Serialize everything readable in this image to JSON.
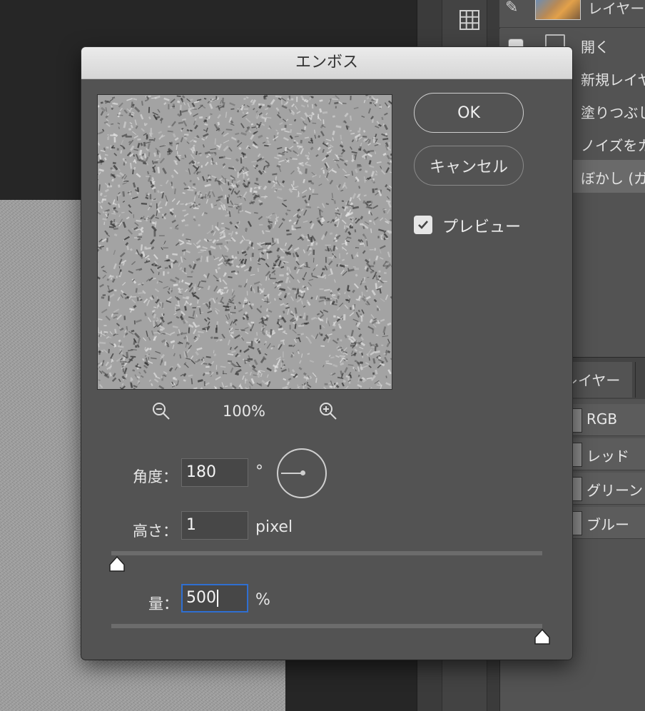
{
  "dialog": {
    "title": "エンボス",
    "ok_label": "OK",
    "cancel_label": "キャンセル",
    "preview_label": "プレビュー",
    "preview_checked": true,
    "zoom_percent": "100%",
    "angle": {
      "label": "角度：",
      "value": "180",
      "unit": "°"
    },
    "height": {
      "label": "高さ：",
      "value": "1",
      "unit": "pixel",
      "slider_fraction": 0.0
    },
    "amount": {
      "label": "量：",
      "value": "500",
      "unit": "%",
      "slider_fraction": 1.0
    }
  },
  "history_panel": {
    "snapshot_label": "レイヤー",
    "items": [
      "開く",
      "新規レイヤ",
      "塗りつぶし",
      "ノイズをカ",
      "ぼかし (ガ"
    ],
    "selected_index": 4
  },
  "layers_tab": {
    "label": "レイヤー"
  },
  "channels": {
    "items": [
      "RGB",
      "レッド",
      "グリーン",
      "ブルー"
    ]
  },
  "colors": {
    "dialog_bg": "#535353",
    "focus_ring": "#2f6fd1"
  }
}
